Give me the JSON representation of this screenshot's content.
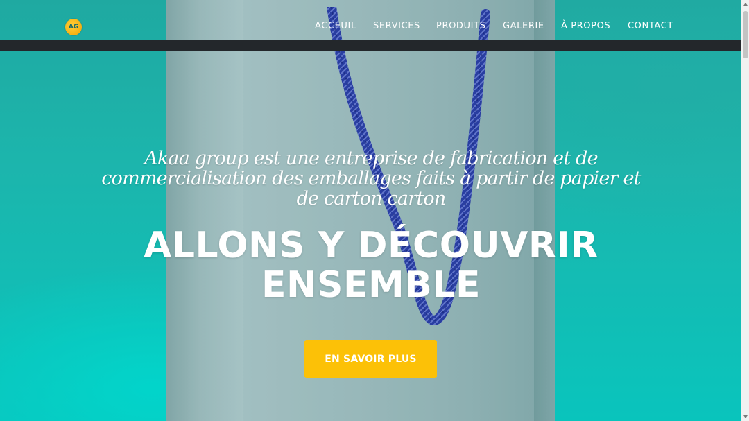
{
  "header": {
    "logo_text": "AG",
    "nav": [
      {
        "label": "ACCEUIL",
        "name": "nav-accueil"
      },
      {
        "label": "SERVICES",
        "name": "nav-services"
      },
      {
        "label": "PRODUITS",
        "name": "nav-produits"
      },
      {
        "label": "GALERIE",
        "name": "nav-galerie"
      },
      {
        "label": "À PROPOS",
        "name": "nav-a-propos"
      },
      {
        "label": "CONTACT",
        "name": "nav-contact"
      }
    ]
  },
  "hero": {
    "subtitle_line1": "Akaa group est une entreprise de fabrication et de",
    "subtitle_line2": "commercialisation des emballages faits à partir de papier et",
    "subtitle_line3": "de carton carton",
    "headline_line1": "ALLONS Y DÉCOUVRIR",
    "headline_line2": "ENSEMBLE",
    "cta_label": "EN SAVOIR PLUS"
  },
  "colors": {
    "hero_teal": "#1fc7bd",
    "dark_strip": "#23272b",
    "cta_yellow": "#fcc107",
    "logo_orange": "#f2a300",
    "text": "#ffffff"
  },
  "icons": {
    "logo": "company-logo-icon",
    "scroll_up": "scroll-up-arrow-icon",
    "scroll_down": "scroll-down-arrow-icon"
  }
}
